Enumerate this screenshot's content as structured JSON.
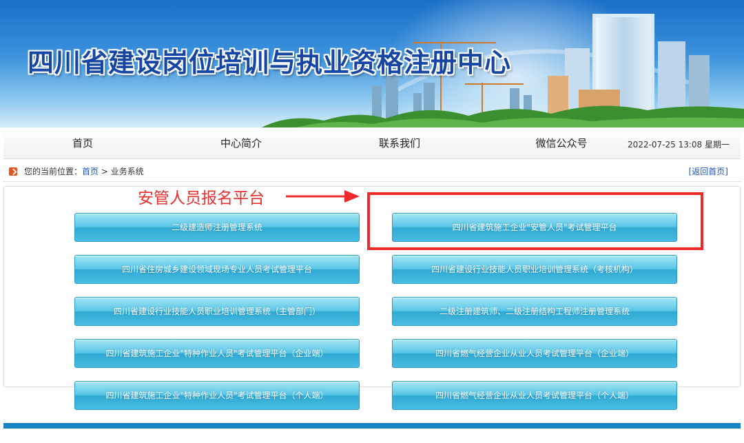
{
  "header": {
    "title": "四川省建设岗位培训与执业资格注册中心"
  },
  "nav": {
    "items": [
      "首页",
      "中心简介",
      "联系我们",
      "微信公众号"
    ],
    "datetime": "2022-07-25 13:08 星期一"
  },
  "breadcrumb": {
    "prefix": "您的当前位置：",
    "home": "首页",
    "separator": " > ",
    "current": "业务系统",
    "back": "[返回首页]"
  },
  "annotation": {
    "label": "安管人员报名平台",
    "color": "#ee2a2a"
  },
  "systems": [
    "二级建造师注册管理系统",
    "四川省建筑施工企业\"安管人员\"考试管理平台",
    "四川省住房城乡建设领域现场专业人员考试管理平台",
    "四川省建设行业技能人员职业培训管理系统（考核机构）",
    "四川省建设行业技能人员职业培训管理系统（主管部门）",
    "二级注册建筑师、二级注册结构工程师注册管理系统",
    "四川省建筑施工企业\"特种作业人员\"考试管理平台（企业端）",
    "四川省燃气经营企业从业人员考试管理平台（企业端）",
    "四川省建筑施工企业\"特种作业人员\"考试管理平台（个人端）",
    "四川省燃气经营企业从业人员考试管理平台（个人端）"
  ],
  "colors": {
    "banner_blue": "#1a6fc9",
    "title_blue": "#1646a4",
    "button_cyan": "#49bce2",
    "footer_blue": "#1583c2",
    "crumb_marker": "#e8521a"
  }
}
